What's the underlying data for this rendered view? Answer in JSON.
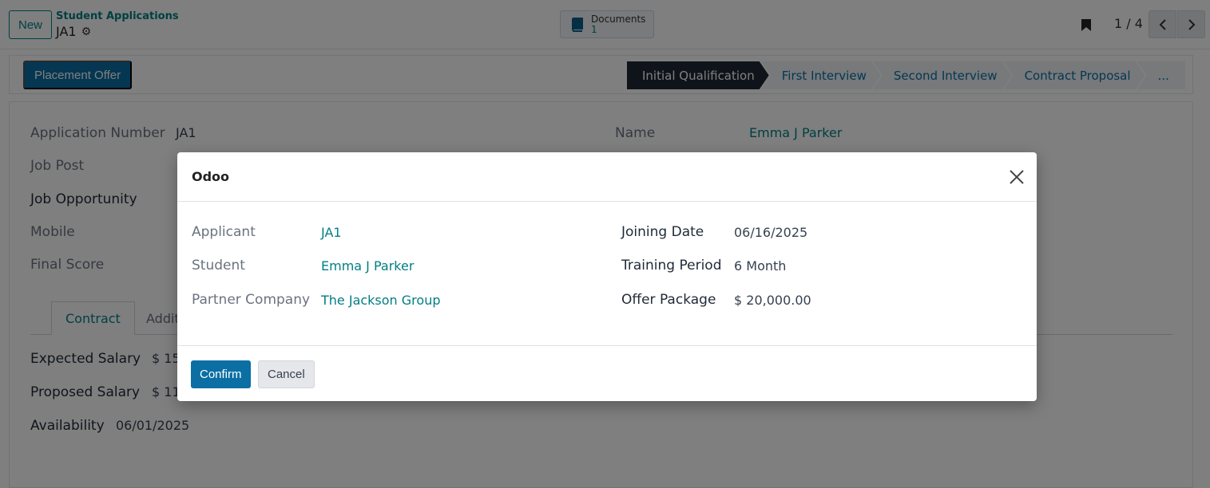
{
  "topbar": {
    "new_label": "New",
    "breadcrumb_parent": "Student Applications",
    "breadcrumb_current": "JA1",
    "documents_label": "Documents",
    "documents_count": "1",
    "pager_text": "1 / 4"
  },
  "statusbar": {
    "placement_offer_label": "Placement Offer",
    "stages": [
      {
        "label": "Initial Qualification"
      },
      {
        "label": "First Interview"
      },
      {
        "label": "Second Interview"
      },
      {
        "label": "Contract Proposal"
      },
      {
        "label": "..."
      }
    ]
  },
  "form": {
    "application_number_label": "Application Number",
    "application_number_value": "JA1",
    "job_post_label": "Job Post",
    "job_opportunity_label": "Job Opportunity",
    "mobile_label": "Mobile",
    "final_score_label": "Final Score",
    "name_label": "Name",
    "name_value": "Emma J Parker",
    "tabs": [
      {
        "label": "Contract"
      },
      {
        "label": "Addit"
      }
    ],
    "expected_salary_label": "Expected Salary",
    "expected_salary_value": "$ 15",
    "proposed_salary_label": "Proposed Salary",
    "proposed_salary_value": "$ 11,",
    "availability_label": "Availability",
    "availability_value": "06/01/2025"
  },
  "modal": {
    "title": "Odoo",
    "applicant_label": "Applicant",
    "applicant_value": "JA1",
    "student_label": "Student",
    "student_value": "Emma J Parker",
    "partner_company_label": "Partner Company",
    "partner_company_value": "The Jackson Group",
    "joining_date_label": "Joining Date",
    "joining_date_value": "06/16/2025",
    "training_period_label": "Training Period",
    "training_period_value": "6 Month",
    "offer_package_label": "Offer Package",
    "offer_package_value": "$ 20,000.00",
    "confirm_label": "Confirm",
    "cancel_label": "Cancel"
  },
  "colors": {
    "primary": "#0b6fa4",
    "link": "#017e84",
    "active_stage": "#1f2937"
  }
}
